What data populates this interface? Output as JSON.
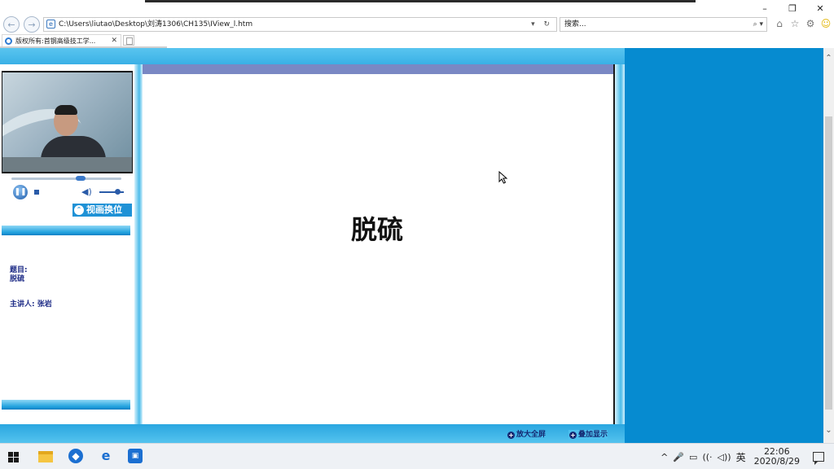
{
  "window": {
    "controls": {
      "minimize": "–",
      "restore": "❐",
      "close": "✕"
    }
  },
  "toolbar": {
    "back_icon": "←",
    "forward_icon": "→",
    "address": "C:\\Users\\liutao\\Desktop\\刘涛1306\\CH135\\IView_l.htm",
    "address_tools": "▾ ↻",
    "search_placeholder": "搜索...",
    "search_tools": "⌕ ▾",
    "home_icon": "⌂",
    "favorites_icon": "☆",
    "settings_icon": "⚙",
    "feedback_icon": "☺"
  },
  "tabs": [
    {
      "label": "版权所有:首钢高级技工学...",
      "close": "✕"
    }
  ],
  "player": {
    "swap_label": "视画换位",
    "swap_icon": "⌃",
    "play_icon": "❚❚",
    "volume_icon": "◀)",
    "seek_fraction": 0.63,
    "volume_fraction": 0.75
  },
  "course": {
    "topic_label": "题目:",
    "topic_value": "脱硫",
    "lecturer_label": "主讲人:",
    "lecturer_value": "张岩"
  },
  "slide": {
    "title": "脱硫"
  },
  "bottom_buttons": {
    "fullscreen": "放大全屏",
    "overlay": "叠加显示"
  },
  "scrollbar": {
    "up": "⌃",
    "down": "⌄"
  },
  "taskbar": {
    "tray_up": "^",
    "mic": "🎤",
    "battery": "▭",
    "network": "((·",
    "volume": "◁))",
    "ime": "英",
    "time": "22:06",
    "date": "2020/8/29"
  },
  "colors": {
    "side_panel": "#068bd0",
    "slide_header": "#7a88c4",
    "page_bars": "#3ab0e6",
    "course_text": "#1d2b86"
  }
}
